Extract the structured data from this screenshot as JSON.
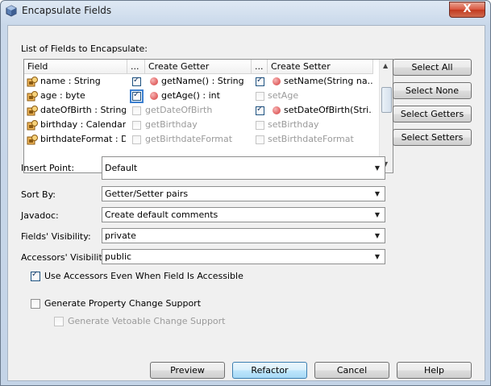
{
  "window": {
    "title": "Encapsulate Fields",
    "close_label": "X"
  },
  "list_label": "List of Fields to Encapsulate:",
  "table": {
    "headers": {
      "field": "Field",
      "dots1": "...",
      "getter": "Create Getter",
      "dots2": "...",
      "setter": "Create Setter"
    },
    "rows": [
      {
        "field": "name : String",
        "getter": "getName() : String",
        "setter": "setName(String na...",
        "getter_checked": true,
        "setter_checked": true
      },
      {
        "field": "age : byte",
        "getter": "getAge() : int",
        "setter": "setAge",
        "getter_checked": true,
        "setter_checked": false
      },
      {
        "field": "dateOfBirth : String",
        "getter": "getDateOfBirth",
        "setter": "setDateOfBirth(Stri...",
        "getter_checked": false,
        "setter_checked": true
      },
      {
        "field": "birthday : Calendar",
        "getter": "getBirthday",
        "setter": "setBirthday",
        "getter_checked": false,
        "setter_checked": false
      },
      {
        "field": "birthdateFormat : D...",
        "getter": "getBirthdateFormat",
        "setter": "setBirthdateFormat",
        "getter_checked": false,
        "setter_checked": false
      }
    ]
  },
  "side_buttons": {
    "select_all": "Select All",
    "select_none": "Select None",
    "select_getters": "Select Getters",
    "select_setters": "Select Setters"
  },
  "options": {
    "insert_point": {
      "label": "Insert Point:",
      "value": "Default"
    },
    "sort_by": {
      "label": "Sort By:",
      "value": "Getter/Setter pairs"
    },
    "javadoc": {
      "label": "Javadoc:",
      "value": "Create default comments"
    },
    "fields_visibility": {
      "label": "Fields' Visibility:",
      "value": "private"
    },
    "accessors_visibility": {
      "label": "Accessors' Visibility:",
      "value": "public"
    }
  },
  "checkboxes": {
    "use_accessors": {
      "label": "Use Accessors Even When Field Is Accessible",
      "checked": true
    },
    "property_change": {
      "label": "Generate Property Change Support",
      "checked": false
    },
    "vetoable_change": {
      "label": "Generate Vetoable Change Support",
      "checked": false,
      "enabled": false
    }
  },
  "footer": {
    "preview": "Preview",
    "refactor": "Refactor",
    "cancel": "Cancel",
    "help": "Help"
  }
}
